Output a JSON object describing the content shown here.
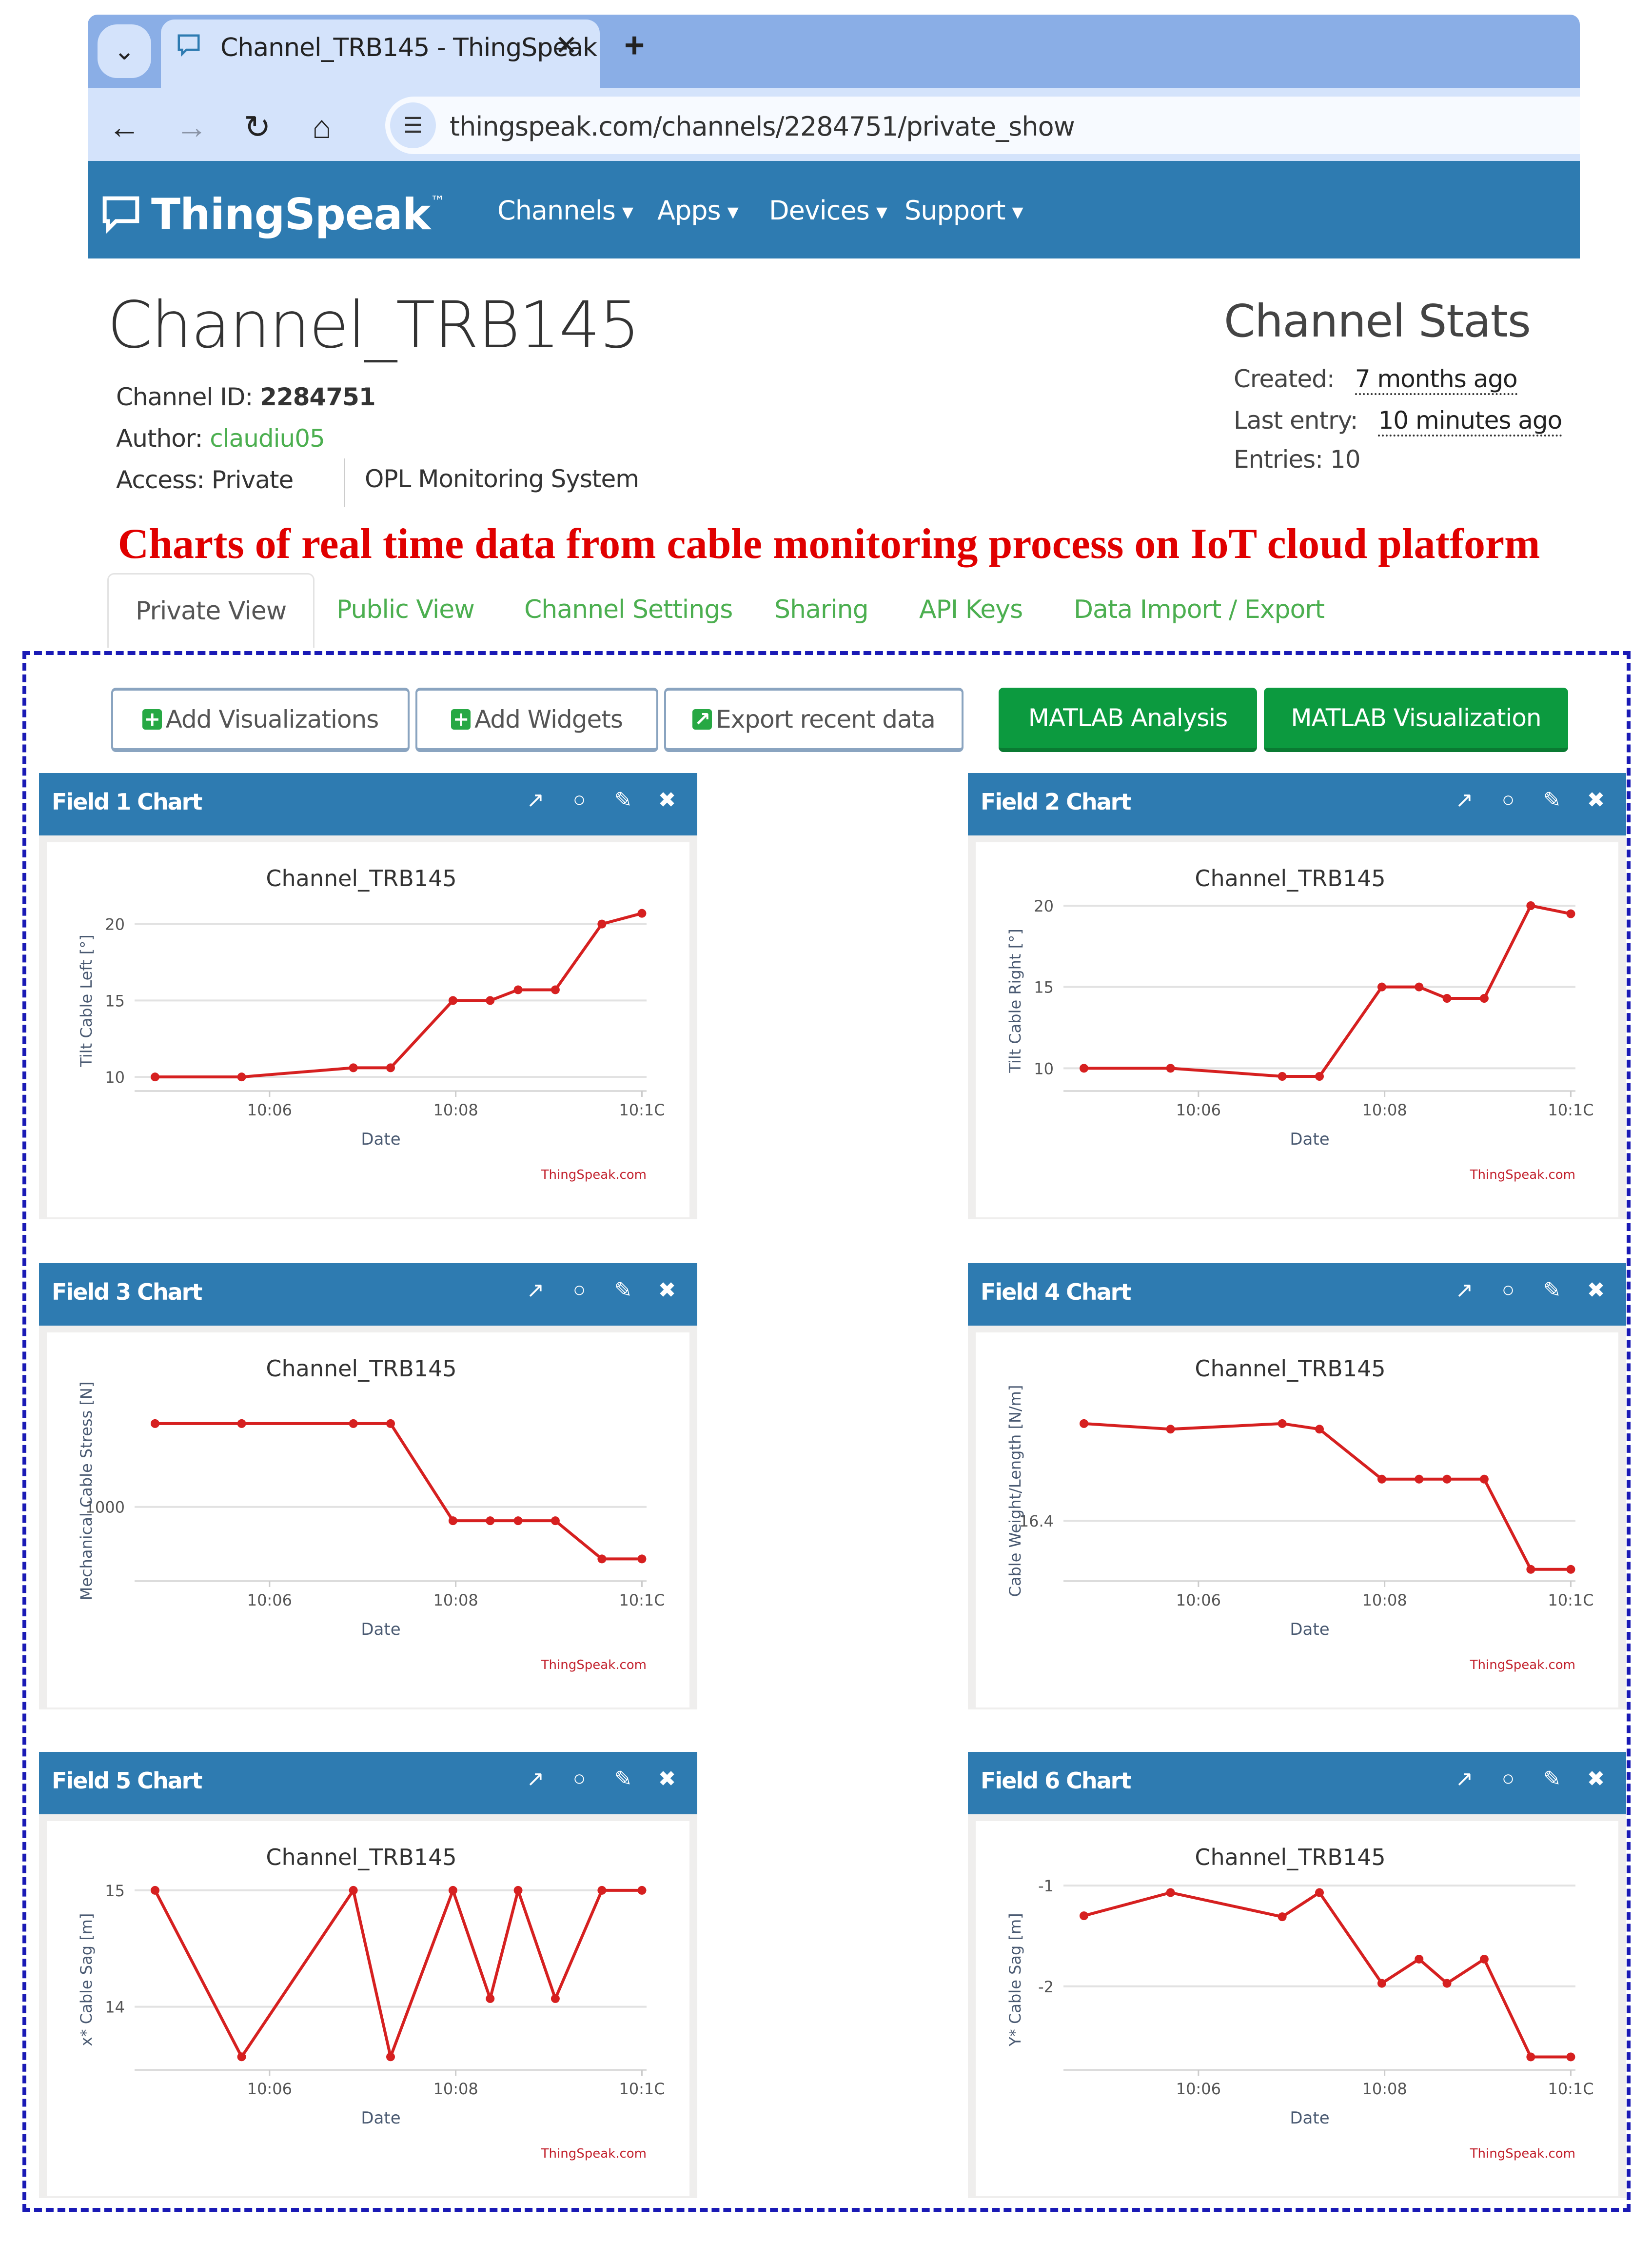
{
  "browser": {
    "tab_title": "Channel_TRB145 - ThingSpeak",
    "url": "thingspeak.com/channels/2284751/private_show",
    "icons": {
      "dropdown": "chevron-down-icon",
      "favicon": "speech-bubble-icon",
      "close": "close-icon",
      "new_tab": "plus-icon",
      "back": "arrow-left-icon",
      "forward": "arrow-right-icon",
      "reload": "reload-icon",
      "home": "home-icon",
      "site_info": "tune-icon"
    }
  },
  "nav": {
    "brand": "ThingSpeak",
    "trademark": "™",
    "menus": [
      {
        "label": "Channels"
      },
      {
        "label": "Apps"
      },
      {
        "label": "Devices"
      },
      {
        "label": "Support"
      }
    ]
  },
  "channel": {
    "title": "Channel_TRB145",
    "id_label": "Channel ID:",
    "id_value": "2284751",
    "author_label": "Author:",
    "author_value": "claudiu05",
    "access_label": "Access:",
    "access_value": "Private",
    "description": "OPL Monitoring System"
  },
  "stats": {
    "title": "Channel Stats",
    "created_label": "Created:",
    "created_value": "7 months ago",
    "last_entry_label": "Last entry:",
    "last_entry_value": "10 minutes ago",
    "entries_label": "Entries:",
    "entries_value": "10"
  },
  "caption": "Charts of real time data from cable monitoring process on IoT cloud platform",
  "tabs": [
    {
      "label": "Private View",
      "active": true
    },
    {
      "label": "Public View"
    },
    {
      "label": "Channel Settings"
    },
    {
      "label": "Sharing"
    },
    {
      "label": "API Keys"
    },
    {
      "label": "Data Import / Export"
    }
  ],
  "actions": {
    "add_visualizations": "Add Visualizations",
    "add_widgets": "Add Widgets",
    "export_recent": "Export recent data",
    "matlab_analysis": "MATLAB Analysis",
    "matlab_visualization": "MATLAB Visualization"
  },
  "colors": {
    "nav_blue": "#2e7bb1",
    "accent_green": "#0c9a3f",
    "link_green": "#4caf50",
    "series_red": "#d62020",
    "caption_red": "#e00000"
  },
  "panel_icons": [
    "external-link-icon",
    "comment-icon",
    "pencil-icon",
    "close-icon"
  ],
  "chart_data": [
    {
      "type": "line",
      "panel_title": "Field 1 Chart",
      "title": "Channel_TRB145",
      "xlabel": "Date",
      "ylabel": "Tilt Cable Left [°]",
      "credit": "ThingSpeak.com",
      "x": [
        "10:04:46",
        "10:05:42",
        "10:06:54",
        "10:07:18",
        "10:07:58",
        "10:08:22",
        "10:08:40",
        "10:09:04",
        "10:09:34",
        "10:10:00"
      ],
      "x_minutes": [
        4.77,
        5.7,
        6.9,
        7.3,
        7.97,
        8.37,
        8.67,
        9.07,
        9.57,
        10.0
      ],
      "values": [
        10.0,
        10.0,
        10.6,
        10.6,
        15.0,
        15.0,
        15.7,
        15.7,
        20.0,
        20.7
      ],
      "yticks": [
        10,
        15,
        20
      ],
      "xticks": [
        "10:06",
        "10:08",
        "10:1C"
      ],
      "xtick_minutes": [
        6,
        8,
        10
      ],
      "ylim": [
        9.4,
        21.2
      ],
      "xlim": [
        4.55,
        10.05
      ]
    },
    {
      "type": "line",
      "panel_title": "Field 2 Chart",
      "title": "Channel_TRB145",
      "xlabel": "Date",
      "ylabel": "Tilt Cable Right [°]",
      "credit": "ThingSpeak.com",
      "x_minutes": [
        4.77,
        5.7,
        6.9,
        7.3,
        7.97,
        8.37,
        8.67,
        9.07,
        9.57,
        10.0
      ],
      "values": [
        10.0,
        10.0,
        9.5,
        9.5,
        15.0,
        15.0,
        14.3,
        14.3,
        20.0,
        19.5
      ],
      "yticks": [
        10,
        15,
        20
      ],
      "xticks": [
        "10:06",
        "10:08",
        "10:1C"
      ],
      "xtick_minutes": [
        6,
        8,
        10
      ],
      "ylim": [
        8.9,
        20.0
      ],
      "xlim": [
        4.55,
        10.05
      ]
    },
    {
      "type": "line",
      "panel_title": "Field 3 Chart",
      "title": "Channel_TRB145",
      "xlabel": "Date",
      "ylabel": "Mechanical Cable Stress [N]",
      "credit": "ThingSpeak.com",
      "x_minutes": [
        4.77,
        5.7,
        6.9,
        7.3,
        7.97,
        8.37,
        8.67,
        9.07,
        9.57,
        10.0
      ],
      "values": [
        1012,
        1012,
        1012,
        1012,
        998,
        998,
        998,
        998,
        992.5,
        992.5
      ],
      "yticks": [
        1000
      ],
      "xticks": [
        "10:06",
        "10:08",
        "10:1C"
      ],
      "xtick_minutes": [
        6,
        8,
        10
      ],
      "ylim": [
        990,
        1016
      ],
      "xlim": [
        4.55,
        10.05
      ]
    },
    {
      "type": "line",
      "panel_title": "Field 4 Chart",
      "title": "Channel_TRB145",
      "xlabel": "Date",
      "ylabel": "Cable Weight/Length [N/m]",
      "credit": "ThingSpeak.com",
      "x_minutes": [
        4.77,
        5.7,
        6.9,
        7.3,
        7.97,
        8.37,
        8.67,
        9.07,
        9.57,
        10.0
      ],
      "values": [
        16.47,
        16.466,
        16.47,
        16.466,
        16.43,
        16.43,
        16.43,
        16.43,
        16.365,
        16.365
      ],
      "yticks": [
        16.4
      ],
      "xticks": [
        "10:06",
        "10:08",
        "10:1C"
      ],
      "xtick_minutes": [
        6,
        8,
        10
      ],
      "ylim": [
        16.36,
        16.49
      ],
      "xlim": [
        4.55,
        10.05
      ]
    },
    {
      "type": "line",
      "panel_title": "Field 5 Chart",
      "title": "Channel_TRB145",
      "xlabel": "Date",
      "ylabel": "x* Cable Sag [m]",
      "credit": "ThingSpeak.com",
      "x_minutes": [
        4.77,
        5.7,
        6.9,
        7.3,
        7.97,
        8.37,
        8.67,
        9.07,
        9.57,
        10.0
      ],
      "values": [
        15.0,
        13.57,
        15.0,
        13.57,
        15.0,
        14.07,
        15.0,
        14.07,
        15.0,
        15.0
      ],
      "yticks": [
        14,
        15
      ],
      "xticks": [
        "10:06",
        "10:08",
        "10:1C"
      ],
      "xtick_minutes": [
        6,
        8,
        10
      ],
      "ylim": [
        13.5,
        15.05
      ],
      "xlim": [
        4.55,
        10.05
      ]
    },
    {
      "type": "line",
      "panel_title": "Field 6 Chart",
      "title": "Channel_TRB145",
      "xlabel": "Date",
      "ylabel": "Y* Cable Sag [m]",
      "credit": "ThingSpeak.com",
      "x_minutes": [
        4.77,
        5.7,
        6.9,
        7.3,
        7.97,
        8.37,
        8.67,
        9.07,
        9.57,
        10.0
      ],
      "values": [
        -1.3,
        -1.07,
        -1.31,
        -1.07,
        -1.97,
        -1.73,
        -1.97,
        -1.73,
        -2.7,
        -2.7
      ],
      "yticks": [
        -1,
        -2
      ],
      "xticks": [
        "10:06",
        "10:08",
        "10:1C"
      ],
      "xtick_minutes": [
        6,
        8,
        10
      ],
      "ylim": [
        -2.78,
        -0.99
      ],
      "xlim": [
        4.55,
        10.05
      ]
    }
  ]
}
